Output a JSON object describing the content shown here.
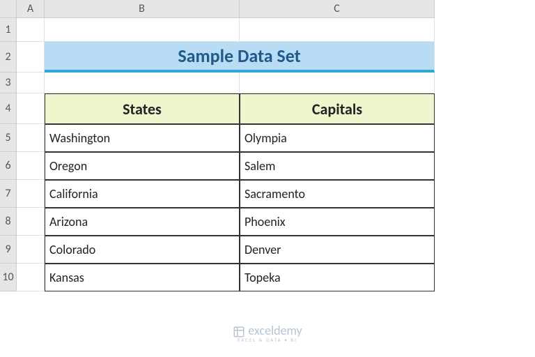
{
  "columns": [
    "A",
    "B",
    "C"
  ],
  "rows": [
    "1",
    "2",
    "3",
    "4",
    "5",
    "6",
    "7",
    "8",
    "9",
    "10"
  ],
  "title": "Sample Data Set",
  "headers": {
    "col1": "States",
    "col2": "Capitals"
  },
  "data": [
    {
      "state": "Washington",
      "capital": "Olympia"
    },
    {
      "state": "Oregon",
      "capital": "Salem"
    },
    {
      "state": "California",
      "capital": "Sacramento"
    },
    {
      "state": "Arizona",
      "capital": "Phoenix"
    },
    {
      "state": "Colorado",
      "capital": "Denver"
    },
    {
      "state": "Kansas",
      "capital": "Topeka"
    }
  ],
  "watermark": {
    "name": "exceldemy",
    "tagline": "EXCEL & DATA • BI"
  }
}
